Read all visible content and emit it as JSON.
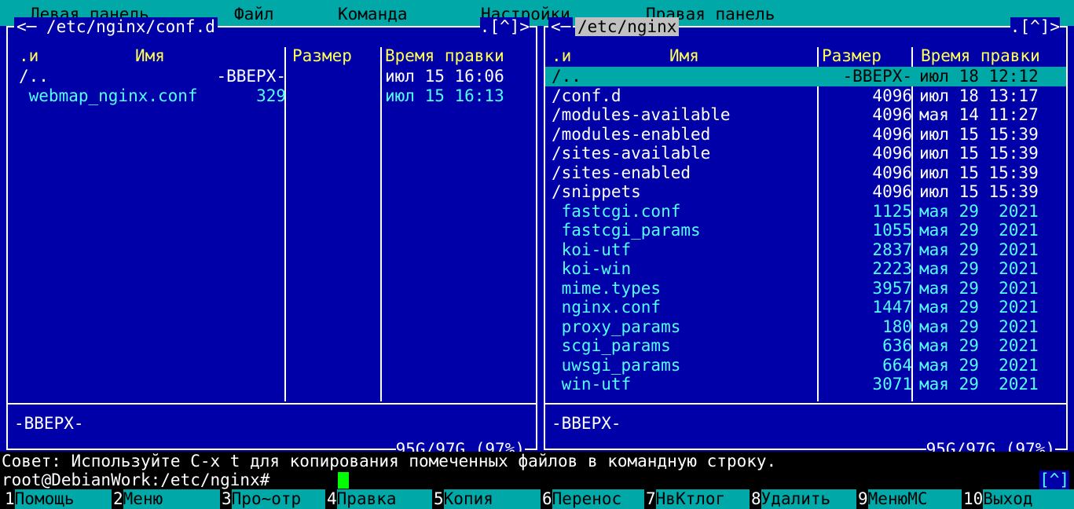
{
  "menubar": {
    "items": [
      "Левая панель",
      "Файл",
      "Команда",
      "Настройки",
      "Правая панель"
    ]
  },
  "left_panel": {
    "path": "<─ /etc/nginx/conf.d",
    "corner": ".[^]>",
    "headers": {
      "mark": ".и",
      "name": "Имя",
      "size": "Размер",
      "time": "Время правки"
    },
    "rows": [
      {
        "name": "/..",
        "size": "-ВВЕРХ-",
        "time": "июл 15 16:06"
      },
      {
        "name": " webmap_nginx.conf",
        "size": "329",
        "time": "июл 15 16:13"
      }
    ],
    "status": "-ВВЕРХ-",
    "free": "95G/97G (97%)"
  },
  "right_panel": {
    "path": "/etc/nginx",
    "arrow": "<─",
    "corner": ".[^]>",
    "headers": {
      "mark": ".и",
      "name": "Имя",
      "size": "Размер",
      "time": "Время правки"
    },
    "rows": [
      {
        "name": "/..",
        "size": "-ВВЕРХ-",
        "time": "июл 18 12:12",
        "type": "sel"
      },
      {
        "name": "/conf.d",
        "size": "4096",
        "time": "июл 18 13:17",
        "type": "dir"
      },
      {
        "name": "/modules-available",
        "size": "4096",
        "time": "мая 14 11:27",
        "type": "dir"
      },
      {
        "name": "/modules-enabled",
        "size": "4096",
        "time": "июл 15 15:39",
        "type": "dir"
      },
      {
        "name": "/sites-available",
        "size": "4096",
        "time": "июл 15 15:39",
        "type": "dir"
      },
      {
        "name": "/sites-enabled",
        "size": "4096",
        "time": "июл 15 15:39",
        "type": "dir"
      },
      {
        "name": "/snippets",
        "size": "4096",
        "time": "июл 15 15:39",
        "type": "dir"
      },
      {
        "name": " fastcgi.conf",
        "size": "1125",
        "time": "мая 29  2021",
        "type": "file"
      },
      {
        "name": " fastcgi_params",
        "size": "1055",
        "time": "мая 29  2021",
        "type": "file"
      },
      {
        "name": " koi-utf",
        "size": "2837",
        "time": "мая 29  2021",
        "type": "file"
      },
      {
        "name": " koi-win",
        "size": "2223",
        "time": "мая 29  2021",
        "type": "file"
      },
      {
        "name": " mime.types",
        "size": "3957",
        "time": "мая 29  2021",
        "type": "file"
      },
      {
        "name": " nginx.conf",
        "size": "1447",
        "time": "мая 29  2021",
        "type": "file"
      },
      {
        "name": " proxy_params",
        "size": "180",
        "time": "мая 29  2021",
        "type": "file"
      },
      {
        "name": " scgi_params",
        "size": "636",
        "time": "мая 29  2021",
        "type": "file"
      },
      {
        "name": " uwsgi_params",
        "size": "664",
        "time": "мая 29  2021",
        "type": "file"
      },
      {
        "name": " win-utf",
        "size": "3071",
        "time": "мая 29  2021",
        "type": "file"
      }
    ],
    "status": "-ВВЕРХ-",
    "free": "95G/97G (97%)"
  },
  "hint": "Совет: Используйте C-x t для копирования помеченных файлов в командную строку.",
  "prompt": "root@DebianWork:/etc/nginx#",
  "history_button": "[^]",
  "fkeys": [
    {
      "num": "1",
      "label": "Помощь"
    },
    {
      "num": "2",
      "label": "Меню"
    },
    {
      "num": "3",
      "label": "Про~отр"
    },
    {
      "num": "4",
      "label": "Правка"
    },
    {
      "num": "5",
      "label": "Копия"
    },
    {
      "num": "6",
      "label": "Перенос"
    },
    {
      "num": "7",
      "label": "НвКтлог"
    },
    {
      "num": "8",
      "label": "Удалить"
    },
    {
      "num": "9",
      "label": "МенюMC"
    },
    {
      "num": "10",
      "label": "Выход"
    }
  ],
  "colors": {
    "background": "#0000a8",
    "accent": "#00a8a8",
    "header": "#ffff54",
    "file": "#54fcfc",
    "cursor": "#00ff00"
  }
}
